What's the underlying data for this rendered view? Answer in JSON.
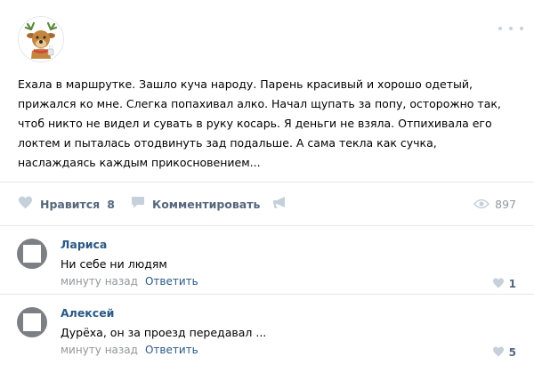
{
  "post": {
    "avatar_icon": "deer-avatar-icon",
    "text": "Ехала в маршрутке. Зашло куча народу. Парень красивый и хорошо одетый,\nприжался ко мне. Слегка попахивал алко. Начал щупать за попу, осторожно так,\nчтоб никто не видел и сувать в руку косарь. Я деньги не взяла. Отпихивала его\nлоктем и пыталась отодвинуть зад подальше. А сама текла как сучка,\nнаслаждаясь каждым прикосновением..."
  },
  "actions": {
    "like_label": "Нравится",
    "like_count": "8",
    "comment_label": "Комментировать",
    "views_count": "897"
  },
  "comments": [
    {
      "author": "Лариса",
      "text": "Ни себе ни людям",
      "time": "минуту назад",
      "reply_label": "Ответить",
      "likes": "1"
    },
    {
      "author": "Алексей",
      "text": "Дурёха, он за проезд передавал ...",
      "time": "минуту назад",
      "reply_label": "Ответить",
      "likes": "5"
    }
  ],
  "colors": {
    "link": "#2a5885",
    "action": "#55677d",
    "muted": "#939699",
    "icon": "#c5d0db",
    "divider": "#e7e8ec"
  }
}
